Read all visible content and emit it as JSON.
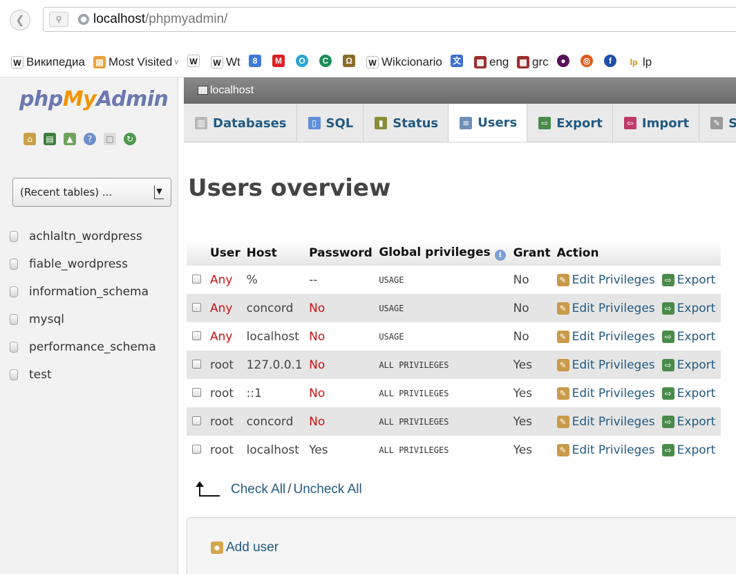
{
  "browser": {
    "url_host": "localhost",
    "url_path": "/phpmyadmin/",
    "bookmarks": [
      {
        "label": "Википедиа",
        "icon": "W"
      },
      {
        "label": "Most Visited",
        "icon": "folder"
      },
      {
        "label": "",
        "icon": "W"
      },
      {
        "label": "Wt",
        "icon": "W"
      },
      {
        "label": "",
        "icon": "8"
      },
      {
        "label": "",
        "icon": "M"
      },
      {
        "label": "",
        "icon": "O"
      },
      {
        "label": "",
        "icon": "C"
      },
      {
        "label": "",
        "icon": "Ω"
      },
      {
        "label": "Wikcionario",
        "icon": "W"
      },
      {
        "label": "",
        "icon": "文"
      },
      {
        "label": "eng",
        "icon": "dict"
      },
      {
        "label": "grc",
        "icon": "dict"
      },
      {
        "label": "",
        "icon": "●"
      },
      {
        "label": "",
        "icon": "◎"
      },
      {
        "label": "",
        "icon": "f"
      },
      {
        "label": "lp",
        "icon": "lp"
      }
    ]
  },
  "sidebar": {
    "logo_php": "php",
    "logo_my": "My",
    "logo_admin": "Admin",
    "recent_tables": "(Recent tables) ...",
    "databases": [
      "achlaltn_wordpress",
      "fiable_wordpress",
      "information_schema",
      "mysql",
      "performance_schema",
      "test"
    ]
  },
  "server": {
    "name": "localhost"
  },
  "tabs": [
    {
      "label": "Databases",
      "active": false
    },
    {
      "label": "SQL",
      "active": false
    },
    {
      "label": "Status",
      "active": false
    },
    {
      "label": "Users",
      "active": true
    },
    {
      "label": "Export",
      "active": false
    },
    {
      "label": "Import",
      "active": false
    },
    {
      "label": "Settin",
      "active": false
    }
  ],
  "main": {
    "title": "Users overview",
    "columns": [
      "User",
      "Host",
      "Password",
      "Global privileges",
      "Grant",
      "Action"
    ],
    "rows": [
      {
        "user": "Any",
        "host": "%",
        "password": "--",
        "privileges": "USAGE",
        "grant": "No"
      },
      {
        "user": "Any",
        "host": "concord",
        "password": "No",
        "privileges": "USAGE",
        "grant": "No"
      },
      {
        "user": "Any",
        "host": "localhost",
        "password": "No",
        "privileges": "USAGE",
        "grant": "No"
      },
      {
        "user": "root",
        "host": "127.0.0.1",
        "password": "No",
        "privileges": "ALL PRIVILEGES",
        "grant": "Yes"
      },
      {
        "user": "root",
        "host": "::1",
        "password": "No",
        "privileges": "ALL PRIVILEGES",
        "grant": "Yes"
      },
      {
        "user": "root",
        "host": "concord",
        "password": "No",
        "privileges": "ALL PRIVILEGES",
        "grant": "Yes"
      },
      {
        "user": "root",
        "host": "localhost",
        "password": "Yes",
        "privileges": "ALL PRIVILEGES",
        "grant": "Yes"
      }
    ],
    "edit_label": "Edit Privileges",
    "export_label": "Export",
    "check_all": "Check All",
    "separator": "/",
    "uncheck_all": "Uncheck All",
    "add_user": "Add user"
  },
  "colors": {
    "link": "#235a81",
    "red": "#cc1111",
    "logo_blue": "#6c78af",
    "logo_orange": "#f29400"
  }
}
